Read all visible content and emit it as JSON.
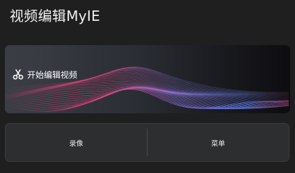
{
  "header": {
    "title": "视频编辑MyIE"
  },
  "hero": {
    "label": "开始编辑视频",
    "icon": "scissors-icon"
  },
  "actions": {
    "record_label": "录像",
    "menu_label": "菜单"
  },
  "colors": {
    "background": "#1f1f1f",
    "card": "#2d2e2f",
    "wave_pink": "#e0457a",
    "wave_blue": "#7a8cff"
  }
}
